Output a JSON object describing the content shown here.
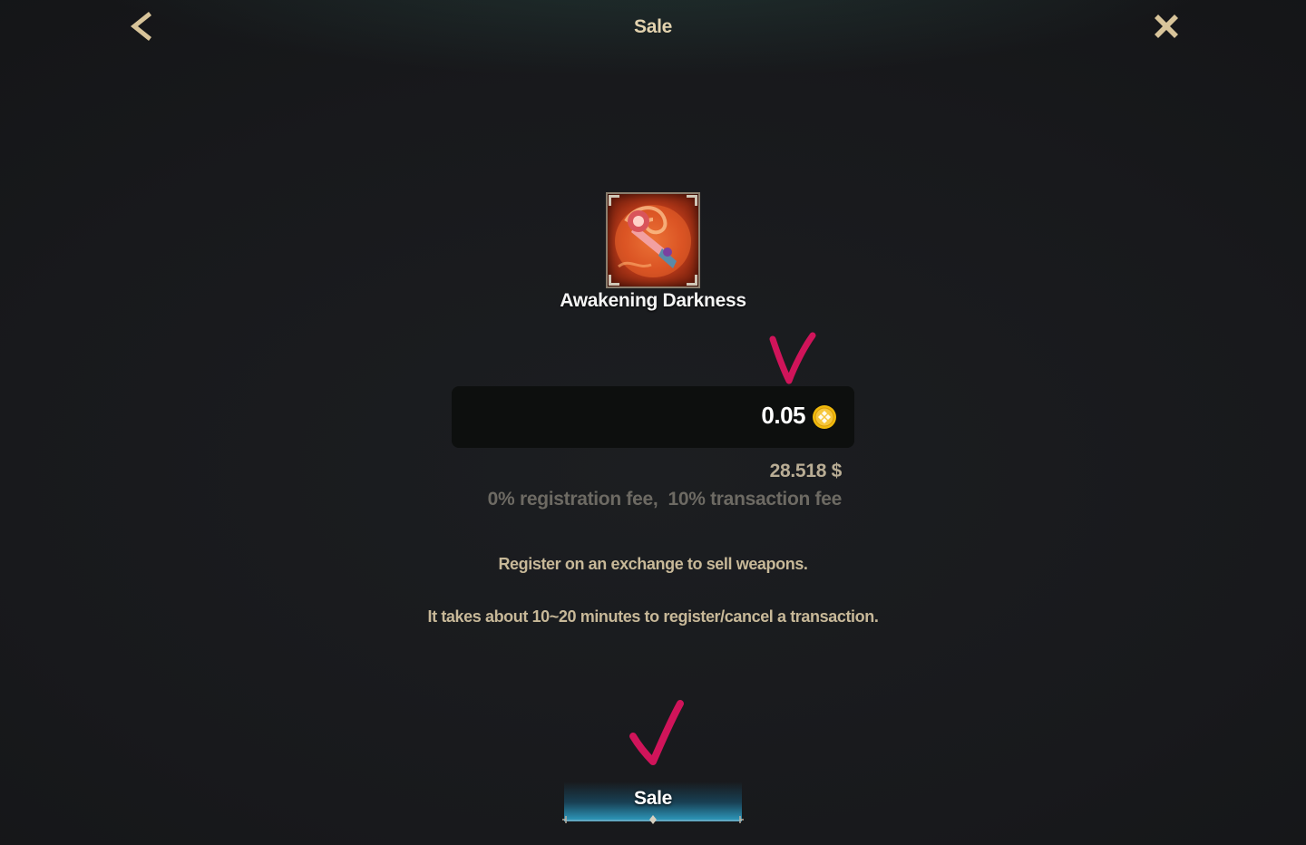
{
  "header": {
    "title": "Sale",
    "back_icon": "chevron-left-icon",
    "close_icon": "close-icon"
  },
  "item": {
    "name": "Awakening Darkness",
    "icon": "weapon-icon"
  },
  "price": {
    "value": "0.05",
    "currency_icon": "bnb-coin-icon",
    "usd": "28.518 $",
    "fees": "0% registration fee,  10% transaction fee"
  },
  "info": {
    "line1": "Register on an exchange to sell weapons.",
    "line2": "It takes about 10~20 minutes to register/cancel a transaction."
  },
  "sale_button": {
    "label": "Sale"
  },
  "colors": {
    "accent_gold": "#e2d2ae",
    "coin": "#f0b90b",
    "check_mark": "#d0145a",
    "button_glow": "#30aad2"
  }
}
